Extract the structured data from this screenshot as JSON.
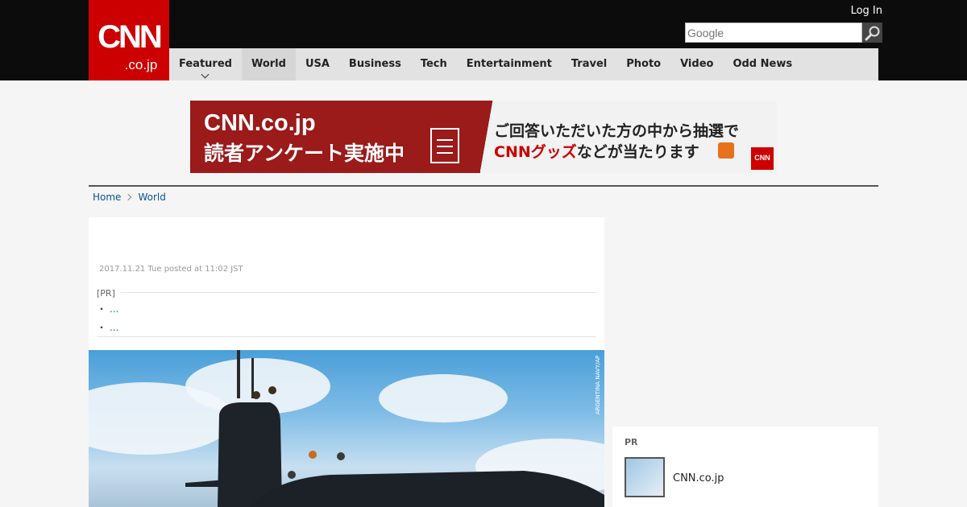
{
  "header": {
    "logo_main": "CNN",
    "logo_sub": ".co.jp",
    "login": "Log In",
    "search_placeholder": "Google"
  },
  "nav": {
    "items": [
      {
        "label": "Featured"
      },
      {
        "label": "World"
      },
      {
        "label": "USA"
      },
      {
        "label": "Business"
      },
      {
        "label": "Tech"
      },
      {
        "label": "Entertainment"
      },
      {
        "label": "Travel"
      },
      {
        "label": "Photo"
      },
      {
        "label": "Video"
      },
      {
        "label": "Odd News"
      }
    ],
    "active": "World"
  },
  "banner": {
    "title": "CNN.co.jp",
    "subtitle": "読者アンケート実施中",
    "right_line1": "ご回答いただいた方の中から抽選で",
    "right_line2_highlight": "CNNグッズ",
    "right_line2_rest": "などが当たります",
    "badge": "CNN"
  },
  "breadcrumb": {
    "home": "Home",
    "current": "World"
  },
  "article": {
    "posted": "2017.11.21 Tue posted at 11:02 JST",
    "pr_label": "[PR]",
    "pr_links": [
      {
        "bullet": "・",
        "text": "..."
      },
      {
        "bullet": "・",
        "text": "..."
      }
    ],
    "photo_credit": "ARGENTINA NAVY/AP"
  },
  "sidebar": {
    "pr_label": "PR",
    "item_name": "CNN.co.jp"
  },
  "colors": {
    "brand_red": "#cc0000",
    "topbar": "#0c0c0c",
    "nav_bg": "#e2e2e2",
    "link": "#0b5394"
  }
}
